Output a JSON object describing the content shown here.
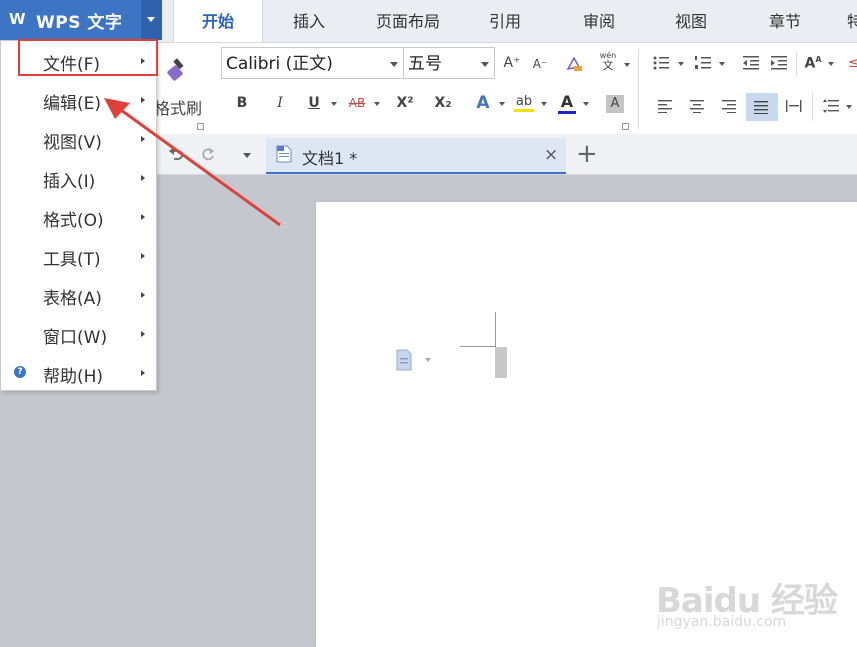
{
  "app": {
    "name": "WPS 文字",
    "logo_glyph": "W"
  },
  "ribbon_tabs": [
    "开始",
    "插入",
    "页面布局",
    "引用",
    "审阅",
    "视图",
    "章节",
    "特"
  ],
  "ribbon": {
    "format_painter_label": "格式刷",
    "font_name": "Calibri (正文)",
    "font_size": "五号",
    "bold": "B",
    "italic": "I",
    "underline": "U",
    "strikethrough": "AB",
    "superscript": "X²",
    "subscript": "X₂",
    "grow_font": "A⁺",
    "shrink_font": "A⁻",
    "pinyin_top": "wén",
    "pinyin_bottom": "文",
    "font_color_glyph": "A",
    "text_effect_glyph": "A",
    "char_shading_glyph": "A",
    "highlight_glyph": "ab"
  },
  "doc_tab": {
    "title": "文档1 *",
    "close": "×",
    "new_tab": "+"
  },
  "menu": {
    "items": [
      {
        "label": "文件(F)"
      },
      {
        "label": "编辑(E)"
      },
      {
        "label": "视图(V)"
      },
      {
        "label": "插入(I)"
      },
      {
        "label": "格式(O)"
      },
      {
        "label": "工具(T)"
      },
      {
        "label": "表格(A)"
      },
      {
        "label": "窗口(W)"
      },
      {
        "label": "帮助(H)"
      }
    ],
    "help_icon_glyph": "?"
  },
  "watermark": {
    "main": "Baidu 经验",
    "sub": "jingyan.baidu.com"
  },
  "colors": {
    "accent": "#3d74c4",
    "annotation": "#e0403a"
  }
}
